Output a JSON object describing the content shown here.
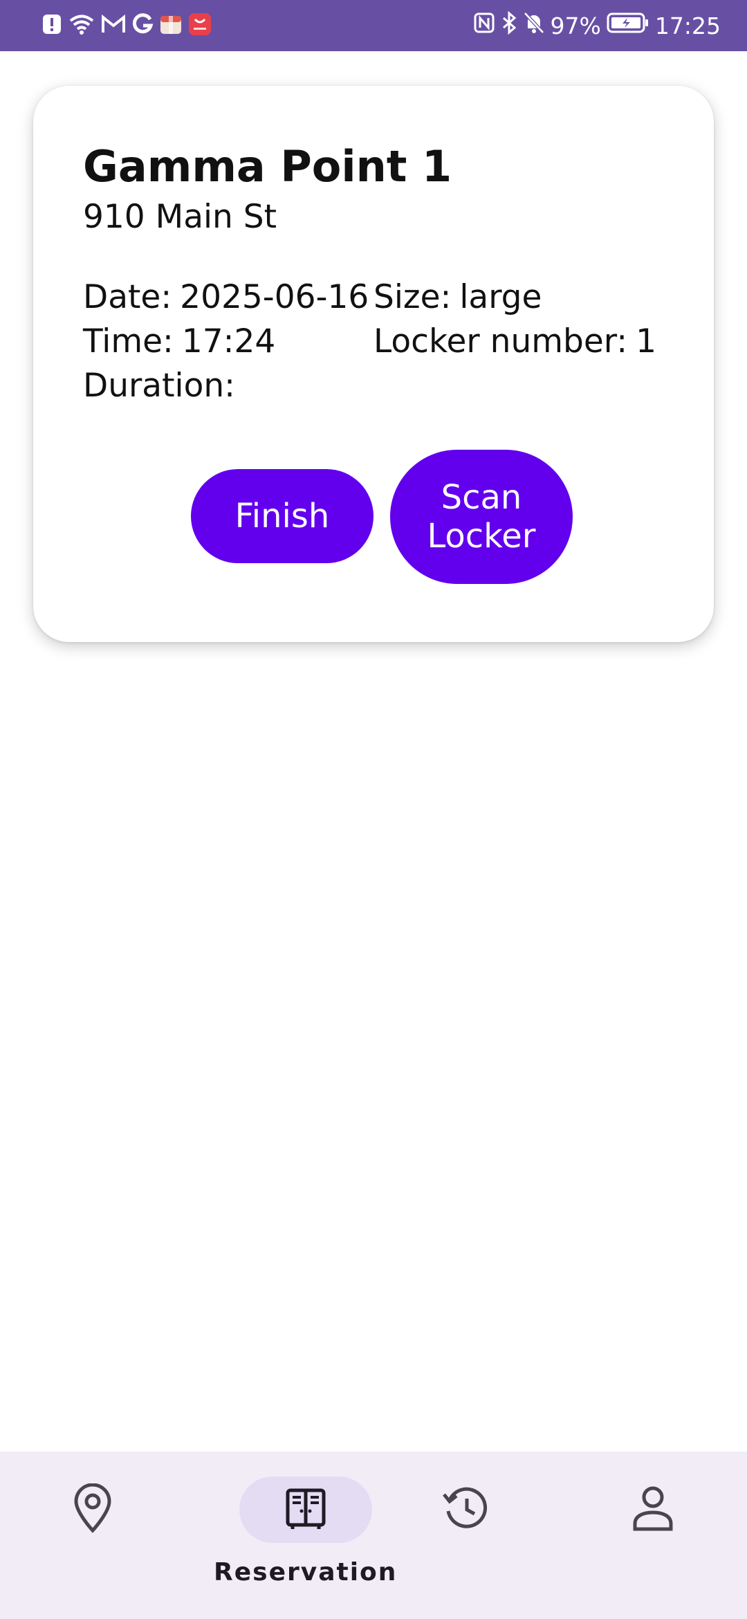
{
  "status_bar": {
    "battery": "97%",
    "time": "17:25",
    "background_color": "#6750a4"
  },
  "card": {
    "title": "Gamma Point 1",
    "address": "910 Main St",
    "date_label": "Date:",
    "date_value": "2025-06-16",
    "time_label": "Time:",
    "time_value": "17:24",
    "duration_label": "Duration:",
    "duration_value": "",
    "size_label": "Size:",
    "size_value": "large",
    "locker_label": "Locker number:",
    "locker_value": "1",
    "finish_button": "Finish",
    "scan_button_line1": "Scan",
    "scan_button_line2": "Locker",
    "accent_color": "#6200ee"
  },
  "bottom_nav": {
    "items": [
      {
        "icon": "location-pin-icon",
        "label": ""
      },
      {
        "icon": "locker-icon",
        "label": "Reservation",
        "active": true
      },
      {
        "icon": "history-icon",
        "label": ""
      },
      {
        "icon": "profile-icon",
        "label": ""
      }
    ]
  }
}
